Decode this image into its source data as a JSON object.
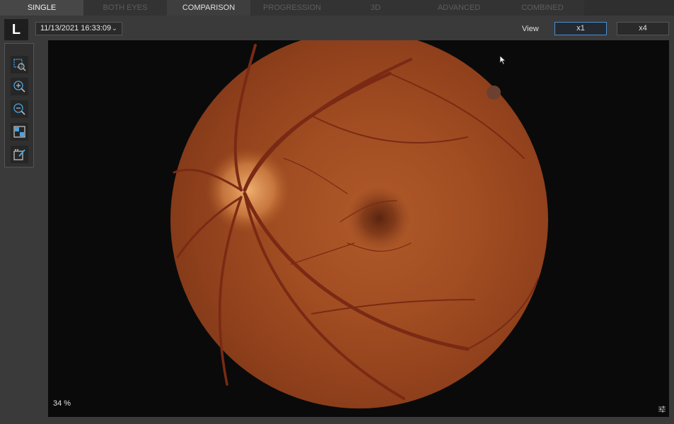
{
  "tabs": [
    {
      "label": "SINGLE",
      "state": "active"
    },
    {
      "label": "BOTH EYES",
      "state": "disabled"
    },
    {
      "label": "COMPARISON",
      "state": "light"
    },
    {
      "label": "PROGRESSION",
      "state": "disabled"
    },
    {
      "label": "3D",
      "state": "disabled"
    },
    {
      "label": "ADVANCED",
      "state": "disabled"
    },
    {
      "label": "COMBINED",
      "state": "disabled"
    }
  ],
  "eye": "L",
  "date_select": {
    "value": "11/13/2021 16:33:09"
  },
  "view": {
    "label": "View",
    "x1": "x1",
    "x4": "x4"
  },
  "tools": [
    "zoom-region-icon",
    "zoom-in-icon",
    "zoom-out-icon",
    "compare-icon",
    "edit-icon"
  ],
  "viewer": {
    "zoom_percent": "34 %"
  },
  "colors": {
    "accent": "#4a8fd0",
    "tool_icon": "#4aa3e0",
    "background": "#0a0a0a"
  }
}
